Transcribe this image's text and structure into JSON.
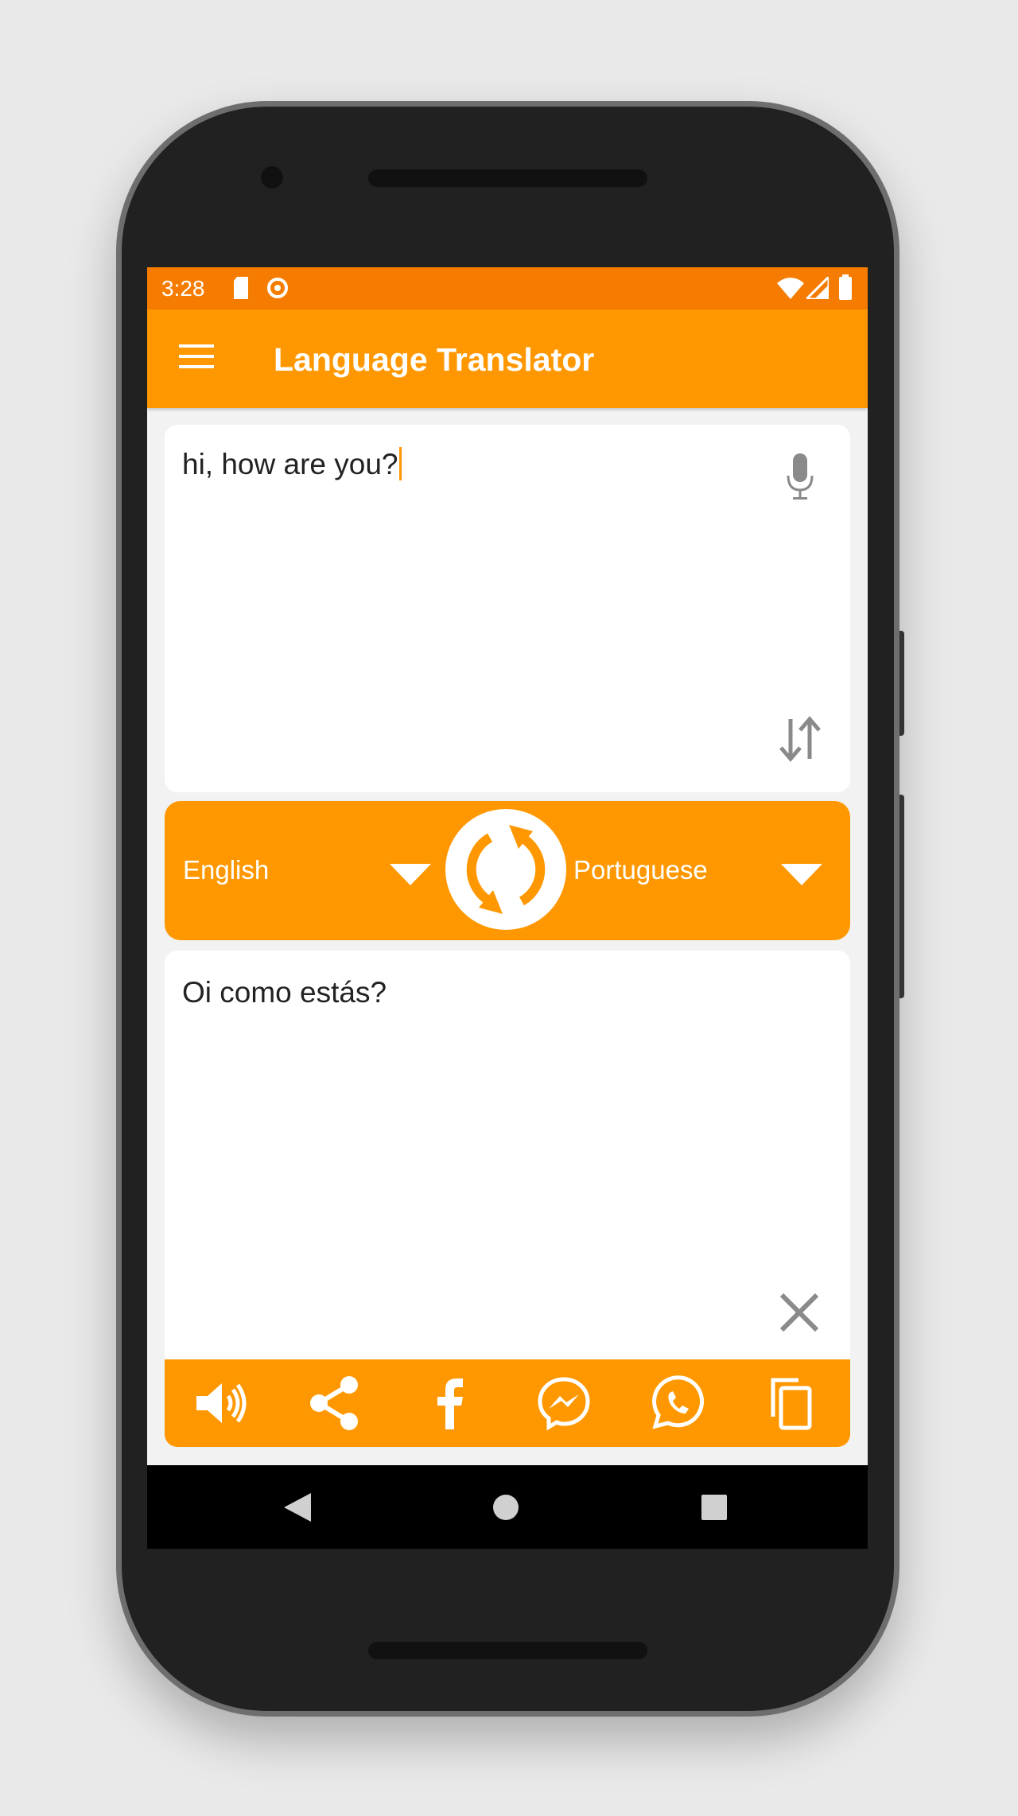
{
  "status_bar": {
    "time": "3:28",
    "icons": [
      "sd-card-icon",
      "app-notification-icon",
      "wifi-icon",
      "signal-icon",
      "battery-icon"
    ]
  },
  "app_bar": {
    "title": "Language Translator",
    "menu_icon": "hamburger-menu-icon"
  },
  "input": {
    "text": "hi, how are you?",
    "icons": [
      "microphone-icon",
      "swap-vertical-icon"
    ]
  },
  "languages": {
    "source": "English",
    "target": "Portuguese",
    "swap_icon": "swap-languages-icon"
  },
  "output": {
    "text": "Oi como estás?",
    "clear_icon": "close-icon"
  },
  "actions": [
    "speaker-icon",
    "share-icon",
    "facebook-icon",
    "messenger-icon",
    "whatsapp-icon",
    "copy-icon"
  ],
  "colors": {
    "primary": "#ff9800",
    "status_bar": "#f57c00",
    "icon_gray": "#8a8a8a"
  }
}
